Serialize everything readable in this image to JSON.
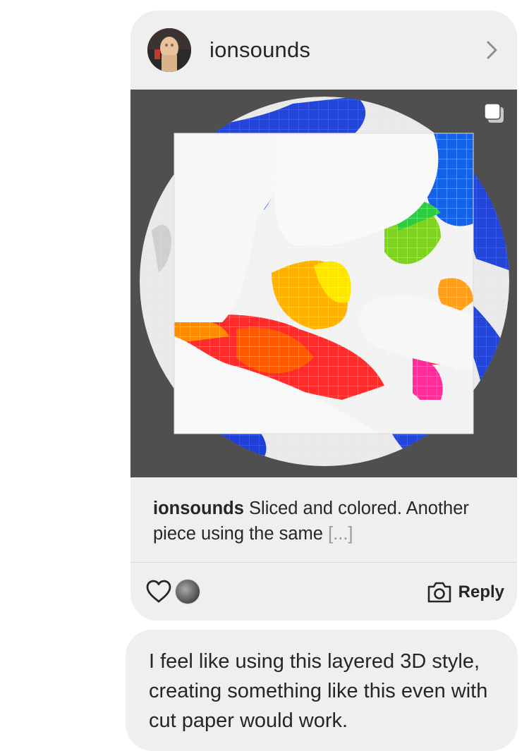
{
  "shared_post": {
    "username": "ionsounds",
    "caption": {
      "user": "ionsounds",
      "text": "Sliced and colored. Another piece using the same",
      "more": "[...]"
    },
    "actions": {
      "reply_label": "Reply"
    },
    "icons": {
      "avatar": "profile-avatar",
      "chevron": "chevron-right-icon",
      "multi_image": "carousel-icon",
      "like": "heart-icon",
      "camera": "camera-icon"
    }
  },
  "message": {
    "text": "I feel like using this layered 3D style, creating something like this even with cut paper would work."
  },
  "colors": {
    "bubble_background": "#efefef",
    "text": "#262626",
    "muted": "#9a9a9a",
    "image_background": "#4f4f4f"
  }
}
